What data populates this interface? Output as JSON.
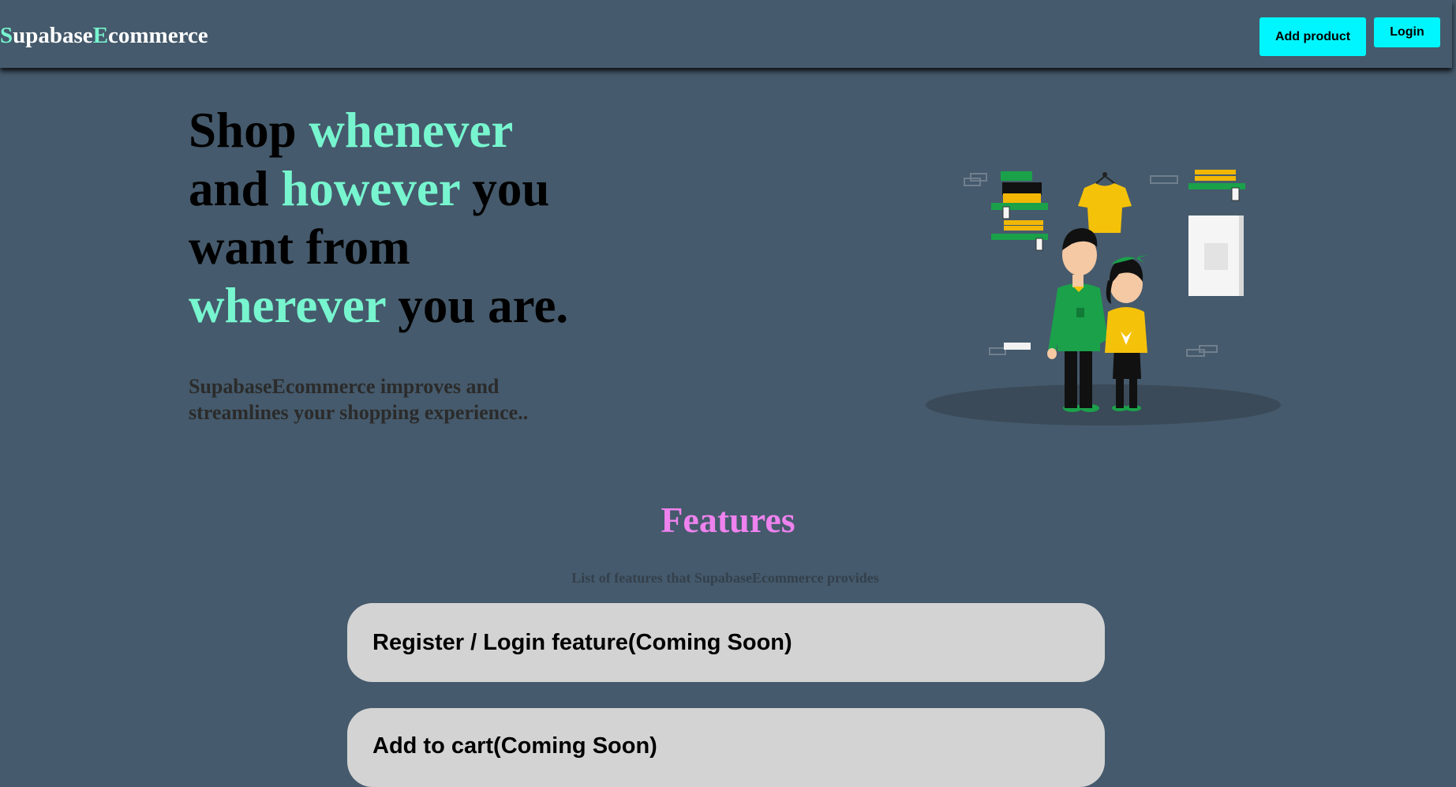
{
  "navbar": {
    "brand_first_letter": "S",
    "brand_middle": "upabase",
    "brand_second_letter": "E",
    "brand_end": "commerce",
    "add_product_label": "Add product",
    "login_label": "Login"
  },
  "hero": {
    "line1_a": "Shop ",
    "line1_b": "whenever",
    "line2_a": "and ",
    "line2_b": "however",
    "line2_c": " you",
    "line3": "want from",
    "line4_a": "wherever",
    "line4_b": " you are.",
    "subtitle": "SupabaseEcommerce improves and streamlines your shopping experience.."
  },
  "features": {
    "title": "Features",
    "subtitle": "List of features that SupabaseEcommerce provides",
    "items": [
      "Register / Login feature(Coming Soon)",
      "Add to cart(Coming Soon)"
    ]
  },
  "colors": {
    "background": "#455a6c",
    "accent": "#77f5cf",
    "button": "#00f6ff",
    "features_title": "#ee82ee",
    "card": "#d3d3d3"
  },
  "illustration": {
    "icon": "shopping-couple-illustration"
  }
}
